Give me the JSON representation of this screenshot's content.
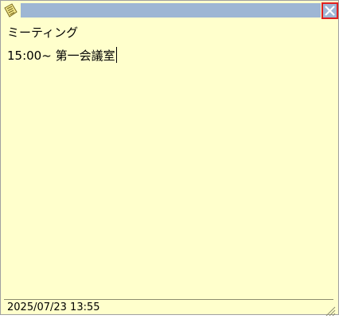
{
  "title_bar": {
    "icon": "notepad-icon",
    "close_icon": "close-x-icon",
    "strip_color": "#9eb6d4",
    "close_border_color": "#e02020"
  },
  "note": {
    "lines": [
      "ミーティング",
      "15:00~ 第一会議室"
    ],
    "background_color": "#ffffcc"
  },
  "status_bar": {
    "timestamp": "2025/07/23 13:55",
    "resize_icon": "resize-grip-icon"
  }
}
